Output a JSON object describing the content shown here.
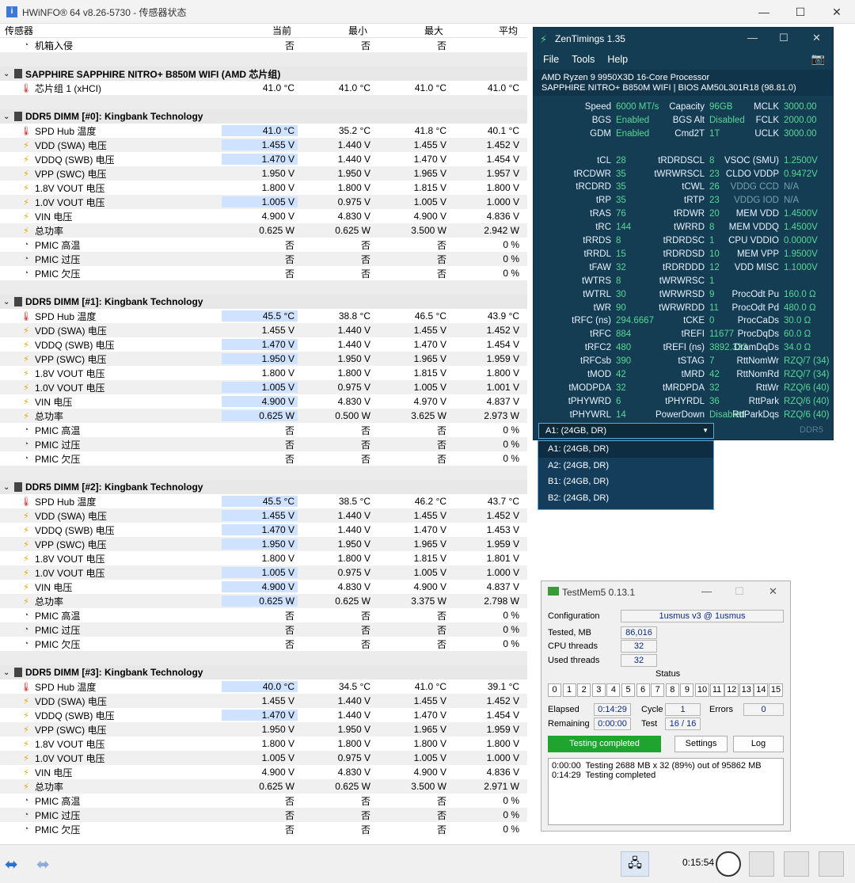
{
  "hwinfo": {
    "title": "HWiNFO® 64 v8.26-5730 - 传感器状态",
    "columns": {
      "sensor": "传感器",
      "current": "当前",
      "min": "最小",
      "max": "最大",
      "avg": "平均"
    },
    "top_row": {
      "name": "机箱入侵",
      "current": "否",
      "min": "否",
      "max": "否",
      "avg": ""
    },
    "groups": [
      {
        "title": "SAPPHIRE SAPPHIRE NITRO+ B850M WIFI (AMD 芯片组)",
        "rows": [
          {
            "icon": "t",
            "name": "芯片组 1 (xHCI)",
            "current": "41.0 °C",
            "min": "41.0 °C",
            "max": "41.0 °C",
            "avg": "41.0 °C",
            "hl": false
          }
        ]
      },
      {
        "title": "DDR5 DIMM [#0]: Kingbank Technology",
        "rows": [
          {
            "icon": "t",
            "name": "SPD Hub 温度",
            "current": "41.0 °C",
            "min": "35.2 °C",
            "max": "41.8 °C",
            "avg": "40.1 °C",
            "hl": true
          },
          {
            "icon": "v",
            "name": "VDD (SWA) 电压",
            "current": "1.455 V",
            "min": "1.440 V",
            "max": "1.455 V",
            "avg": "1.452 V",
            "hl": true
          },
          {
            "icon": "v",
            "name": "VDDQ (SWB) 电压",
            "current": "1.470 V",
            "min": "1.440 V",
            "max": "1.470 V",
            "avg": "1.454 V",
            "hl": true
          },
          {
            "icon": "v",
            "name": "VPP (SWC) 电压",
            "current": "1.950 V",
            "min": "1.950 V",
            "max": "1.965 V",
            "avg": "1.957 V",
            "hl": false
          },
          {
            "icon": "v",
            "name": "1.8V VOUT 电压",
            "current": "1.800 V",
            "min": "1.800 V",
            "max": "1.815 V",
            "avg": "1.800 V",
            "hl": false
          },
          {
            "icon": "v",
            "name": "1.0V VOUT 电压",
            "current": "1.005 V",
            "min": "0.975 V",
            "max": "1.005 V",
            "avg": "1.000 V",
            "hl": true
          },
          {
            "icon": "v",
            "name": "VIN 电压",
            "current": "4.900 V",
            "min": "4.830 V",
            "max": "4.900 V",
            "avg": "4.836 V",
            "hl": false
          },
          {
            "icon": "p",
            "name": "总功率",
            "current": "0.625 W",
            "min": "0.625 W",
            "max": "3.500 W",
            "avg": "2.942 W",
            "hl": false
          },
          {
            "icon": "s",
            "name": "PMIC 高温",
            "current": "否",
            "min": "否",
            "max": "否",
            "avg": "0 %",
            "hl": false
          },
          {
            "icon": "s",
            "name": "PMIC 过压",
            "current": "否",
            "min": "否",
            "max": "否",
            "avg": "0 %",
            "hl": false
          },
          {
            "icon": "s",
            "name": "PMIC 欠压",
            "current": "否",
            "min": "否",
            "max": "否",
            "avg": "0 %",
            "hl": false
          }
        ]
      },
      {
        "title": "DDR5 DIMM [#1]: Kingbank Technology",
        "rows": [
          {
            "icon": "t",
            "name": "SPD Hub 温度",
            "current": "45.5 °C",
            "min": "38.8 °C",
            "max": "46.5 °C",
            "avg": "43.9 °C",
            "hl": true
          },
          {
            "icon": "v",
            "name": "VDD (SWA) 电压",
            "current": "1.455 V",
            "min": "1.440 V",
            "max": "1.455 V",
            "avg": "1.452 V",
            "hl": false
          },
          {
            "icon": "v",
            "name": "VDDQ (SWB) 电压",
            "current": "1.470 V",
            "min": "1.440 V",
            "max": "1.470 V",
            "avg": "1.454 V",
            "hl": true
          },
          {
            "icon": "v",
            "name": "VPP (SWC) 电压",
            "current": "1.950 V",
            "min": "1.950 V",
            "max": "1.965 V",
            "avg": "1.959 V",
            "hl": true
          },
          {
            "icon": "v",
            "name": "1.8V VOUT 电压",
            "current": "1.800 V",
            "min": "1.800 V",
            "max": "1.815 V",
            "avg": "1.800 V",
            "hl": false
          },
          {
            "icon": "v",
            "name": "1.0V VOUT 电压",
            "current": "1.005 V",
            "min": "0.975 V",
            "max": "1.005 V",
            "avg": "1.001 V",
            "hl": true
          },
          {
            "icon": "v",
            "name": "VIN 电压",
            "current": "4.900 V",
            "min": "4.830 V",
            "max": "4.970 V",
            "avg": "4.837 V",
            "hl": true
          },
          {
            "icon": "p",
            "name": "总功率",
            "current": "0.625 W",
            "min": "0.500 W",
            "max": "3.625 W",
            "avg": "2.973 W",
            "hl": true
          },
          {
            "icon": "s",
            "name": "PMIC 高温",
            "current": "否",
            "min": "否",
            "max": "否",
            "avg": "0 %",
            "hl": false
          },
          {
            "icon": "s",
            "name": "PMIC 过压",
            "current": "否",
            "min": "否",
            "max": "否",
            "avg": "0 %",
            "hl": false
          },
          {
            "icon": "s",
            "name": "PMIC 欠压",
            "current": "否",
            "min": "否",
            "max": "否",
            "avg": "0 %",
            "hl": false
          }
        ]
      },
      {
        "title": "DDR5 DIMM [#2]: Kingbank Technology",
        "rows": [
          {
            "icon": "t",
            "name": "SPD Hub 温度",
            "current": "45.5 °C",
            "min": "38.5 °C",
            "max": "46.2 °C",
            "avg": "43.7 °C",
            "hl": true
          },
          {
            "icon": "v",
            "name": "VDD (SWA) 电压",
            "current": "1.455 V",
            "min": "1.440 V",
            "max": "1.455 V",
            "avg": "1.452 V",
            "hl": true
          },
          {
            "icon": "v",
            "name": "VDDQ (SWB) 电压",
            "current": "1.470 V",
            "min": "1.440 V",
            "max": "1.470 V",
            "avg": "1.453 V",
            "hl": true
          },
          {
            "icon": "v",
            "name": "VPP (SWC) 电压",
            "current": "1.950 V",
            "min": "1.950 V",
            "max": "1.965 V",
            "avg": "1.959 V",
            "hl": true
          },
          {
            "icon": "v",
            "name": "1.8V VOUT 电压",
            "current": "1.800 V",
            "min": "1.800 V",
            "max": "1.815 V",
            "avg": "1.801 V",
            "hl": false
          },
          {
            "icon": "v",
            "name": "1.0V VOUT 电压",
            "current": "1.005 V",
            "min": "0.975 V",
            "max": "1.005 V",
            "avg": "1.000 V",
            "hl": true
          },
          {
            "icon": "v",
            "name": "VIN 电压",
            "current": "4.900 V",
            "min": "4.830 V",
            "max": "4.900 V",
            "avg": "4.837 V",
            "hl": true
          },
          {
            "icon": "p",
            "name": "总功率",
            "current": "0.625 W",
            "min": "0.625 W",
            "max": "3.375 W",
            "avg": "2.798 W",
            "hl": true
          },
          {
            "icon": "s",
            "name": "PMIC 高温",
            "current": "否",
            "min": "否",
            "max": "否",
            "avg": "0 %",
            "hl": false
          },
          {
            "icon": "s",
            "name": "PMIC 过压",
            "current": "否",
            "min": "否",
            "max": "否",
            "avg": "0 %",
            "hl": false
          },
          {
            "icon": "s",
            "name": "PMIC 欠压",
            "current": "否",
            "min": "否",
            "max": "否",
            "avg": "0 %",
            "hl": false
          }
        ]
      },
      {
        "title": "DDR5 DIMM [#3]: Kingbank Technology",
        "rows": [
          {
            "icon": "t",
            "name": "SPD Hub 温度",
            "current": "40.0 °C",
            "min": "34.5 °C",
            "max": "41.0 °C",
            "avg": "39.1 °C",
            "hl": true
          },
          {
            "icon": "v",
            "name": "VDD (SWA) 电压",
            "current": "1.455 V",
            "min": "1.440 V",
            "max": "1.455 V",
            "avg": "1.452 V",
            "hl": false
          },
          {
            "icon": "v",
            "name": "VDDQ (SWB) 电压",
            "current": "1.470 V",
            "min": "1.440 V",
            "max": "1.470 V",
            "avg": "1.454 V",
            "hl": true
          },
          {
            "icon": "v",
            "name": "VPP (SWC) 电压",
            "current": "1.950 V",
            "min": "1.950 V",
            "max": "1.965 V",
            "avg": "1.959 V",
            "hl": false
          },
          {
            "icon": "v",
            "name": "1.8V VOUT 电压",
            "current": "1.800 V",
            "min": "1.800 V",
            "max": "1.800 V",
            "avg": "1.800 V",
            "hl": false
          },
          {
            "icon": "v",
            "name": "1.0V VOUT 电压",
            "current": "1.005 V",
            "min": "0.975 V",
            "max": "1.005 V",
            "avg": "1.000 V",
            "hl": false
          },
          {
            "icon": "v",
            "name": "VIN 电压",
            "current": "4.900 V",
            "min": "4.830 V",
            "max": "4.900 V",
            "avg": "4.836 V",
            "hl": false
          },
          {
            "icon": "p",
            "name": "总功率",
            "current": "0.625 W",
            "min": "0.625 W",
            "max": "3.500 W",
            "avg": "2.971 W",
            "hl": false
          },
          {
            "icon": "s",
            "name": "PMIC 高温",
            "current": "否",
            "min": "否",
            "max": "否",
            "avg": "0 %",
            "hl": false
          },
          {
            "icon": "s",
            "name": "PMIC 过压",
            "current": "否",
            "min": "否",
            "max": "否",
            "avg": "0 %",
            "hl": false
          },
          {
            "icon": "s",
            "name": "PMIC 欠压",
            "current": "否",
            "min": "否",
            "max": "否",
            "avg": "0 %",
            "hl": false
          }
        ]
      }
    ],
    "bottom": {
      "elapsed": "0:15:54"
    }
  },
  "zentimings": {
    "title": "ZenTimings 1.35",
    "menu": [
      "File",
      "Tools",
      "Help"
    ],
    "cpu": "AMD Ryzen 9 9950X3D 16-Core Processor",
    "board": "SAPPHIRE NITRO+ B850M WIFI | BIOS AM50L301R18 (98.81.0)",
    "rows": [
      [
        [
          "Speed",
          "6000 MT/s",
          0
        ],
        [
          "Capacity",
          "96GB",
          0
        ],
        [
          "MCLK",
          "3000.00",
          0
        ]
      ],
      [
        [
          "BGS",
          "Enabled",
          0
        ],
        [
          "BGS Alt",
          "Disabled",
          0
        ],
        [
          "FCLK",
          "2000.00",
          0
        ]
      ],
      [
        [
          "GDM",
          "Enabled",
          0
        ],
        [
          "Cmd2T",
          "1T",
          0
        ],
        [
          "UCLK",
          "3000.00",
          0
        ]
      ],
      null,
      [
        [
          "tCL",
          "28",
          0
        ],
        [
          "tRDRDSCL",
          "8",
          0
        ],
        [
          "VSOC (SMU)",
          "1.2500V",
          0
        ]
      ],
      [
        [
          "tRCDWR",
          "35",
          0
        ],
        [
          "tWRWRSCL",
          "23",
          0
        ],
        [
          "CLDO VDDP",
          "0.9472V",
          0
        ]
      ],
      [
        [
          "tRCDRD",
          "35",
          0
        ],
        [
          "tCWL",
          "26",
          0
        ],
        [
          "VDDG CCD",
          "N/A",
          1
        ]
      ],
      [
        [
          "tRP",
          "35",
          0
        ],
        [
          "tRTP",
          "23",
          0
        ],
        [
          "VDDG IOD",
          "N/A",
          1
        ]
      ],
      [
        [
          "tRAS",
          "76",
          0
        ],
        [
          "tRDWR",
          "20",
          0
        ],
        [
          "MEM VDD",
          "1.4500V",
          0
        ]
      ],
      [
        [
          "tRC",
          "144",
          0
        ],
        [
          "tWRRD",
          "8",
          0
        ],
        [
          "MEM VDDQ",
          "1.4500V",
          0
        ]
      ],
      [
        [
          "tRRDS",
          "8",
          0
        ],
        [
          "tRDRDSC",
          "1",
          0
        ],
        [
          "CPU VDDIO",
          "0.0000V",
          0
        ]
      ],
      [
        [
          "tRRDL",
          "15",
          0
        ],
        [
          "tRDRDSD",
          "10",
          0
        ],
        [
          "MEM VPP",
          "1.9500V",
          0
        ]
      ],
      [
        [
          "tFAW",
          "32",
          0
        ],
        [
          "tRDRDDD",
          "12",
          0
        ],
        [
          "VDD MISC",
          "1.1000V",
          0
        ]
      ],
      [
        [
          "tWTRS",
          "8",
          0
        ],
        [
          "tWRWRSC",
          "1",
          0
        ],
        [
          "",
          "",
          0
        ]
      ],
      [
        [
          "tWTRL",
          "30",
          0
        ],
        [
          "tWRWRSD",
          "9",
          0
        ],
        [
          "ProcOdt Pu",
          "160.0 Ω",
          0
        ]
      ],
      [
        [
          "tWR",
          "90",
          0
        ],
        [
          "tWRWRDD",
          "11",
          0
        ],
        [
          "ProcOdt Pd",
          "480.0 Ω",
          0
        ]
      ],
      [
        [
          "tRFC (ns)",
          "294.6667",
          0
        ],
        [
          "tCKE",
          "0",
          0
        ],
        [
          "ProcCaDs",
          "30.0 Ω",
          0
        ]
      ],
      [
        [
          "tRFC",
          "884",
          0
        ],
        [
          "tREFI",
          "11677",
          0
        ],
        [
          "ProcDqDs",
          "60.0 Ω",
          0
        ]
      ],
      [
        [
          "tRFC2",
          "480",
          0
        ],
        [
          "tREFI (ns)",
          "3892.333",
          0
        ],
        [
          "DramDqDs",
          "34.0 Ω",
          0
        ]
      ],
      [
        [
          "tRFCsb",
          "390",
          0
        ],
        [
          "tSTAG",
          "7",
          0
        ],
        [
          "RttNomWr",
          "RZQ/7 (34)",
          0
        ]
      ],
      [
        [
          "tMOD",
          "42",
          0
        ],
        [
          "tMRD",
          "42",
          0
        ],
        [
          "RttNomRd",
          "RZQ/7 (34)",
          0
        ]
      ],
      [
        [
          "tMODPDA",
          "32",
          0
        ],
        [
          "tMRDPDA",
          "32",
          0
        ],
        [
          "RttWr",
          "RZQ/6 (40)",
          0
        ]
      ],
      [
        [
          "tPHYWRD",
          "6",
          0
        ],
        [
          "tPHYRDL",
          "36",
          0
        ],
        [
          "RttPark",
          "RZQ/6 (40)",
          0
        ]
      ],
      [
        [
          "tPHYWRL",
          "14",
          0
        ],
        [
          "PowerDown",
          "Disabled",
          0
        ],
        [
          "RttParkDqs",
          "RZQ/6 (40)",
          0
        ]
      ]
    ],
    "selected": "A1:  (24GB, DR)",
    "ddr": "DDR5",
    "options": [
      "A1:  (24GB, DR)",
      "A2:  (24GB, DR)",
      "B1:  (24GB, DR)",
      "B2:  (24GB, DR)"
    ]
  },
  "testmem5": {
    "title": "TestMem5  0.13.1",
    "configuration_label": "Configuration",
    "configuration": "1usmus v3 @ 1usmus",
    "tested_label": "Tested, MB",
    "tested": "86,016",
    "cpu_threads_label": "CPU threads",
    "cpu_threads": "32",
    "used_threads_label": "Used threads",
    "used_threads": "32",
    "status_label": "Status",
    "status_cells": [
      "0",
      "1",
      "2",
      "3",
      "4",
      "5",
      "6",
      "7",
      "8",
      "9",
      "10",
      "11",
      "12",
      "13",
      "14",
      "15"
    ],
    "elapsed_label": "Elapsed",
    "elapsed": "0:14:29",
    "cycle_label": "Cycle",
    "cycle": "1",
    "errors_label": "Errors",
    "errors": "0",
    "remaining_label": "Remaining",
    "remaining": "0:00:00",
    "test_label": "Test",
    "test": "16 / 16",
    "done_label": "Testing completed",
    "settings_label": "Settings",
    "log_label": "Log",
    "log_lines": [
      "0:00:00  Testing 2688 MB x 32 (89%) out of 95862 MB",
      "0:14:29  Testing completed"
    ]
  }
}
